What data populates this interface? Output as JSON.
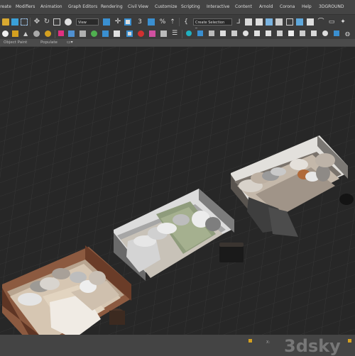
{
  "menu": [
    "Create",
    "Modifiers",
    "Animation",
    "Graph Editors",
    "Rendering",
    "Civil View",
    "Customize",
    "Scripting",
    "Interactive",
    "Content",
    "Arnold",
    "Corona",
    "Help",
    "3DGROUND"
  ],
  "toolbar": {
    "view_dropdown": "View",
    "selection_set": "Create Selection Se"
  },
  "ribbon": {
    "tabs": [
      "Object Paint",
      "Populate"
    ]
  },
  "watermark": "3dsky",
  "colors": {
    "menubar_bg": "#444444",
    "viewport_bg": "#272727",
    "accent": "#f0c000"
  }
}
